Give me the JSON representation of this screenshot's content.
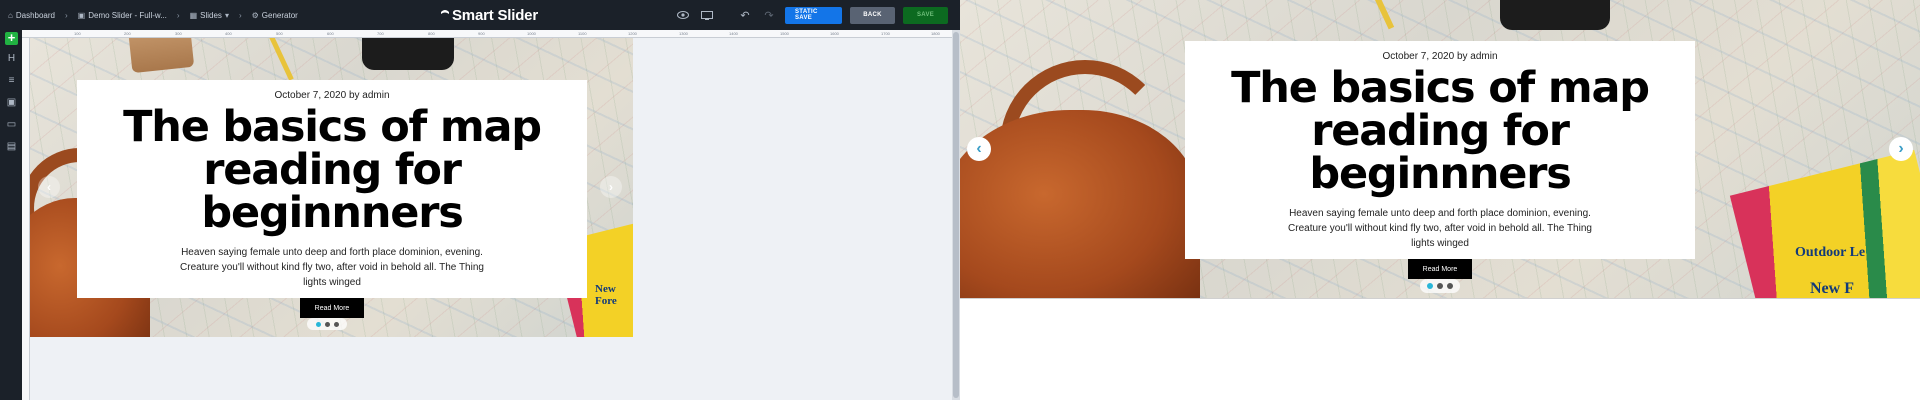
{
  "topbar": {
    "breadcrumbs": [
      {
        "label": "Dashboard",
        "icon": "home-icon"
      },
      {
        "label": "Demo Slider - Full-w...",
        "icon": "slider-icon"
      },
      {
        "label": "Slides",
        "icon": "grid-icon"
      },
      {
        "label": "Generator",
        "icon": "generator-icon"
      }
    ],
    "logo": "Smart Slider",
    "buttons": {
      "static_save": "STATIC SAVE",
      "back": "BACK",
      "save": "SAVE"
    }
  },
  "sidebar": {
    "tools": [
      "add-layer",
      "heading",
      "text",
      "image",
      "button",
      "row"
    ]
  },
  "ruler": {
    "ticks": [
      "100",
      "200",
      "300",
      "400",
      "500",
      "600",
      "700",
      "800",
      "900",
      "1000",
      "1100",
      "1200",
      "1300",
      "1400",
      "1500",
      "1600",
      "1700",
      "1800"
    ]
  },
  "slide": {
    "date": "October 7, 2020 by admin",
    "title_line1": "The basics of map",
    "title_line2": "reading for beginnners",
    "body_line1": "Heaven saying female unto deep and forth place dominion, evening.",
    "body_line2": "Creature you'll without kind fly two, after void in behold all. The Thing",
    "body_line3": "lights winged",
    "button": "Read More",
    "pagination": {
      "count": 3,
      "active": 1
    }
  },
  "colors": {
    "accent": "#1375e8",
    "save": "#0c6a20",
    "topbar": "#1b2129",
    "dot_active": "#29b6d8"
  }
}
